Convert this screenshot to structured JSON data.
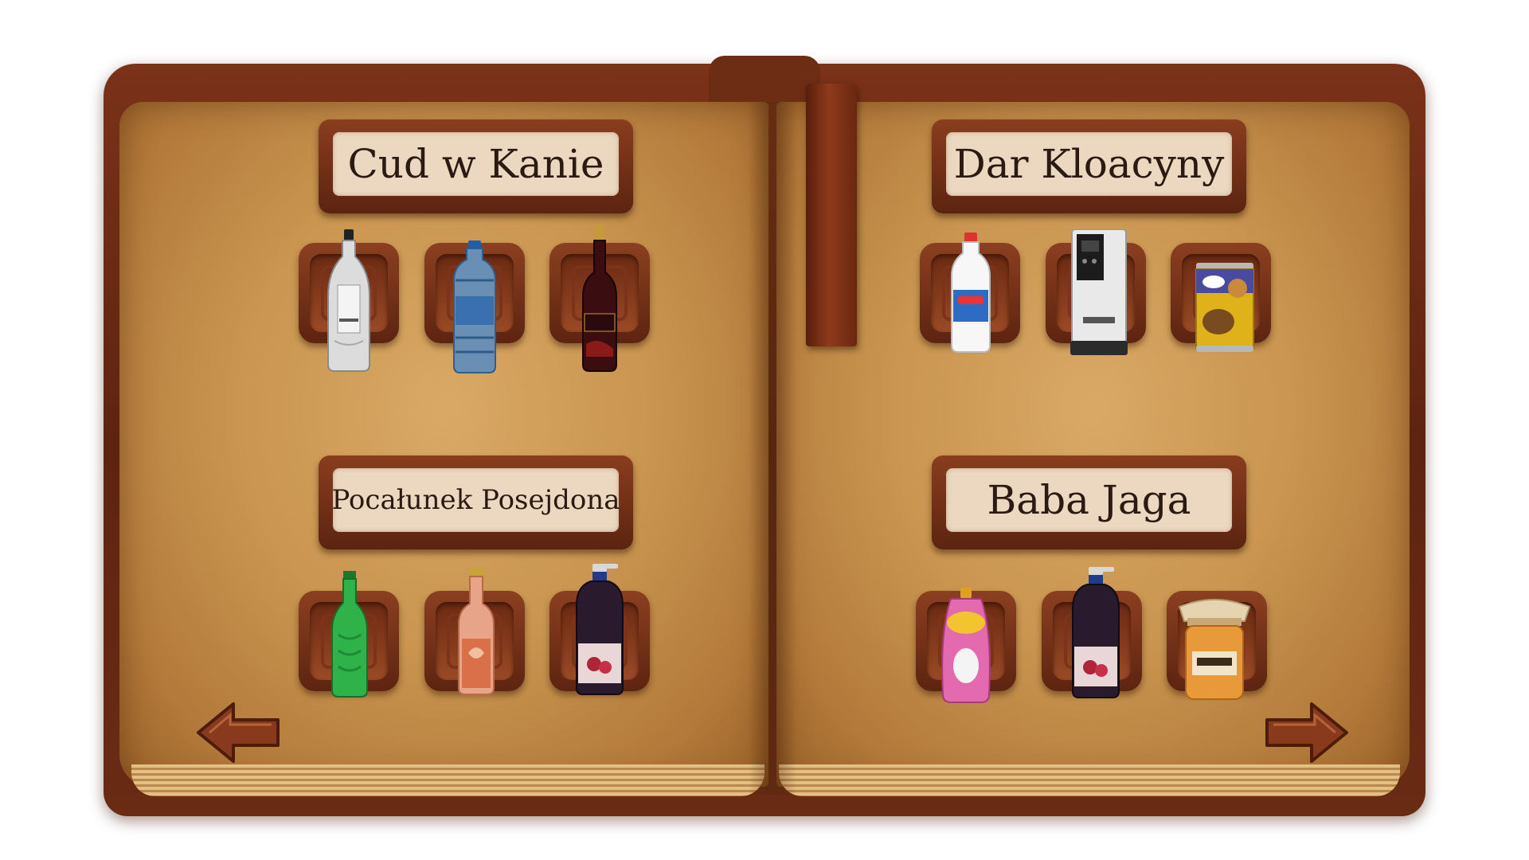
{
  "recipes": [
    {
      "title": "Cud w Kanie",
      "items": [
        {
          "icon": "vodka-bottle-icon"
        },
        {
          "icon": "water-bottle-icon"
        },
        {
          "icon": "wine-bottle-icon"
        }
      ]
    },
    {
      "title": "Dar Kloacyny",
      "items": [
        {
          "icon": "milk-bottle-icon"
        },
        {
          "icon": "coffee-machine-icon"
        },
        {
          "icon": "dog-food-can-icon"
        }
      ]
    },
    {
      "title": "Pocałunek Posejdona",
      "items": [
        {
          "icon": "green-soda-bottle-icon"
        },
        {
          "icon": "juice-bottle-icon"
        },
        {
          "icon": "syrup-jug-icon"
        }
      ]
    },
    {
      "title": "Baba Jaga",
      "items": [
        {
          "icon": "fruit-pouch-icon"
        },
        {
          "icon": "syrup-jug-icon"
        },
        {
          "icon": "honey-jar-icon"
        }
      ]
    }
  ],
  "navigation": {
    "prev_icon": "arrow-left-icon",
    "next_icon": "arrow-right-icon"
  },
  "colors": {
    "leather": "#6d2c14",
    "page": "#c99550",
    "plaque": "#ecd8c0",
    "text": "#2a1a12"
  }
}
